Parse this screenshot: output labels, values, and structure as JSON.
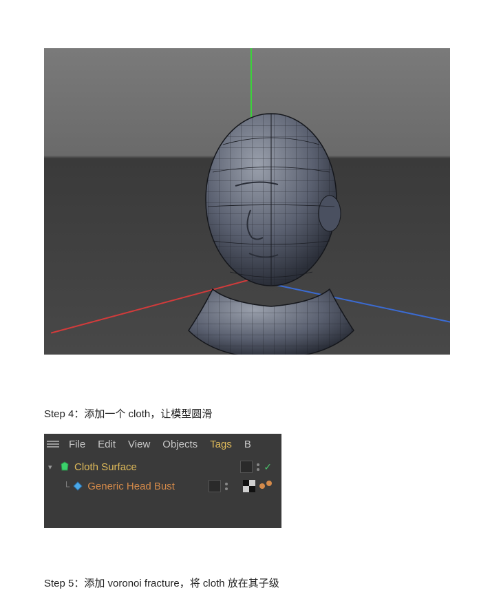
{
  "steps": {
    "step4": "Step 4：添加一个 cloth，让模型圆滑",
    "step5": "Step 5：添加 voronoi fracture，将 cloth 放在其子级"
  },
  "viewport": {
    "model_name": "Generic Head Bust",
    "axes": {
      "x": "red",
      "y": "green",
      "z": "blue"
    }
  },
  "panel": {
    "menu": {
      "file": "File",
      "edit": "Edit",
      "view": "View",
      "objects": "Objects",
      "tags": "Tags",
      "overflow": "B"
    },
    "tree": [
      {
        "label": "Cloth Surface",
        "icon": "cloth-surface-icon"
      },
      {
        "label": "Generic Head Bust",
        "icon": "polygon-object-icon"
      }
    ]
  }
}
